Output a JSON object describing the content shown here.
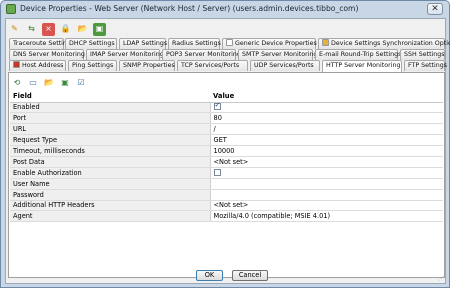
{
  "window": {
    "title": "Device Properties - Web Server (Network Host / Server) (users.admin.devices.tibbo_com)"
  },
  "toolbar": {
    "icons": [
      "toolbar-icon-1",
      "toolbar-icon-2",
      "toolbar-icon-3",
      "toolbar-icon-4",
      "toolbar-icon-5",
      "toolbar-icon-6"
    ]
  },
  "tabs": {
    "row1": [
      "Traceroute Settings",
      "DHCP Settings",
      "LDAP Settings",
      "Radius Settings",
      "Generic Device Properties",
      "Device Settings Synchronization Options"
    ],
    "row2": [
      "DNS Server Monitoring",
      "IMAP Server Monitoring",
      "POP3 Server Monitoring",
      "SMTP Server Monitoring",
      "E-mail Round-Trip Settings",
      "SSH Settings"
    ],
    "row3": [
      "Host Address",
      "Ping Settings",
      "SNMP Properties",
      "TCP Services/Ports",
      "UDP Services/Ports",
      "HTTP Server Monitoring",
      "FTP Settings"
    ],
    "active": "HTTP Server Monitoring"
  },
  "table": {
    "headers": {
      "field": "Field",
      "value": "Value"
    },
    "rows": [
      {
        "field": "Enabled",
        "value": "",
        "checkbox": true
      },
      {
        "field": "Port",
        "value": "80"
      },
      {
        "field": "URL",
        "value": "/"
      },
      {
        "field": "Request Type",
        "value": "GET"
      },
      {
        "field": "Timeout, milliseconds",
        "value": "10000"
      },
      {
        "field": "Post Data",
        "value": "<Not set>"
      },
      {
        "field": "Enable Authorization",
        "value": "",
        "checkbox": false
      },
      {
        "field": "User Name",
        "value": ""
      },
      {
        "field": "Password",
        "value": ""
      },
      {
        "field": "Additional HTTP Headers",
        "value": "<Not set>"
      },
      {
        "field": "Agent",
        "value": "Mozilla/4.0 (compatible; MSIE 4.01)"
      }
    ]
  },
  "buttons": {
    "ok": "OK",
    "cancel": "Cancel"
  }
}
